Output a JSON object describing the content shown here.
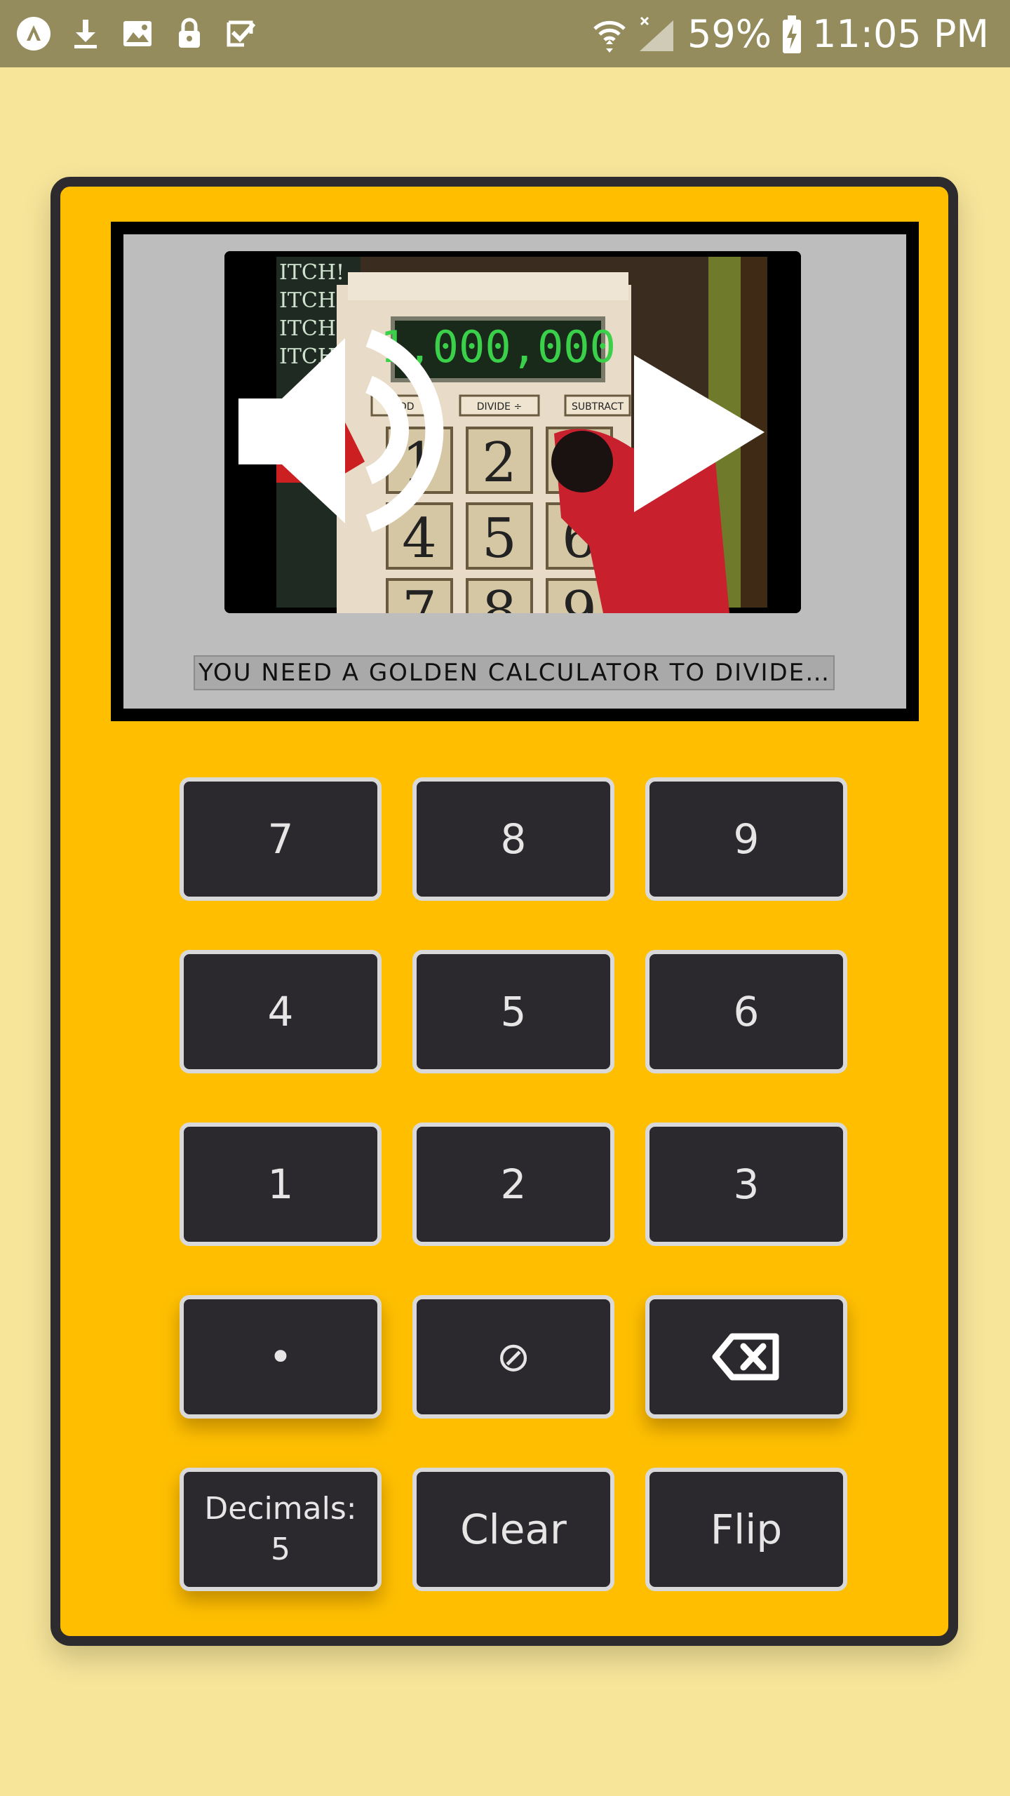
{
  "status_bar": {
    "battery": "59%",
    "time": "11:05 PM",
    "icons": [
      "app-logo-icon",
      "download-icon",
      "image-icon",
      "lock-icon",
      "checkbox-icon",
      "wifi-icon",
      "signal-icon",
      "battery-charging-icon"
    ]
  },
  "player": {
    "video_display_text": "1,000,000",
    "calc_buttons_in_video": [
      "ADD",
      "DIVIDE ÷",
      "SUBTRACT"
    ],
    "calc_digits_in_video": [
      "1",
      "2",
      "3",
      "4",
      "5",
      "6",
      "7",
      "8",
      "9"
    ],
    "caption": "YOU NEED A GOLDEN CALCULATOR TO DIVIDE..."
  },
  "keypad": {
    "rows": [
      [
        "7",
        "8",
        "9"
      ],
      [
        "4",
        "5",
        "6"
      ],
      [
        "1",
        "2",
        "3"
      ]
    ],
    "dot": "•",
    "divide_symbol": "⊘",
    "backspace_icon": "backspace-icon",
    "decimals": "Decimals:\n5",
    "clear": "Clear",
    "flip": "Flip"
  },
  "colors": {
    "background": "#f7e59a",
    "status_bar": "#958c5e",
    "calculator_body": "#ffbf00",
    "calculator_border": "#2d2b2e",
    "key_background": "#2b292d",
    "key_border": "#d9d9d9",
    "screen_background": "#bdbdbd"
  }
}
